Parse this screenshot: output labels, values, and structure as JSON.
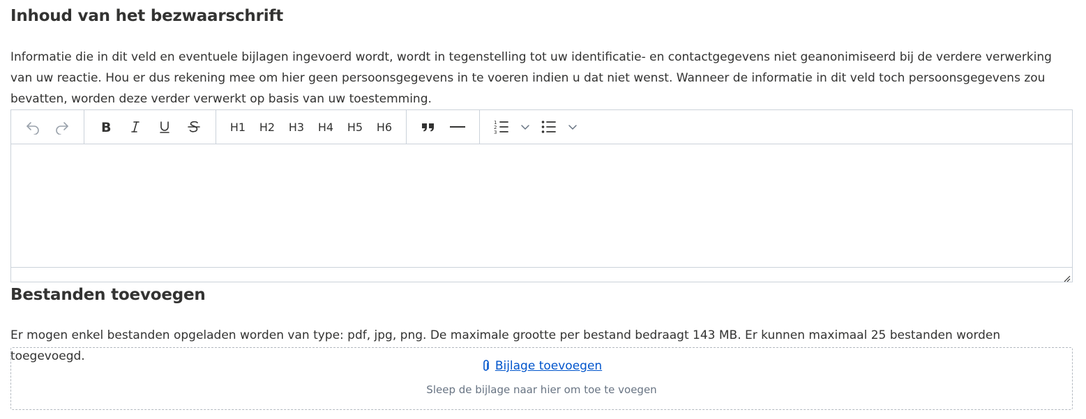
{
  "content_section": {
    "title": "Inhoud van het bezwaarschrift",
    "intro": "Informatie die in dit veld en eventuele bijlagen ingevoerd wordt, wordt in tegenstelling tot uw identificatie- en contactgegevens niet geanonimiseerd bij de verdere verwerking van uw reactie. Hou er dus rekening mee om hier geen persoonsgegevens in te voeren indien u dat niet wenst. Wanneer de informatie in dit veld toch persoonsgegevens zou bevatten, worden deze verder verwerkt op basis van uw toestemming."
  },
  "toolbar": {
    "headings": [
      "H1",
      "H2",
      "H3",
      "H4",
      "H5",
      "H6"
    ],
    "icons": [
      "undo-icon",
      "redo-icon",
      "bold-icon",
      "italic-icon",
      "underline-icon",
      "strikethrough-icon",
      "blockquote-icon",
      "horizontal-rule-icon",
      "ordered-list-icon",
      "chevron-down-icon",
      "bullet-list-icon",
      "chevron-down-icon"
    ]
  },
  "editor": {
    "value": ""
  },
  "files_section": {
    "title": "Bestanden toevoegen",
    "intro": "Er mogen enkel bestanden opgeladen worden van type: pdf, jpg, png. De maximale grootte per bestand bedraagt 143 MB. Er kunnen maximaal 25 bestanden worden toegevoegd.",
    "add_label": "Bijlage toevoegen",
    "drop_hint": "Sleep de bijlage naar hier om toe te voegen",
    "link_color": "#0055cc"
  }
}
